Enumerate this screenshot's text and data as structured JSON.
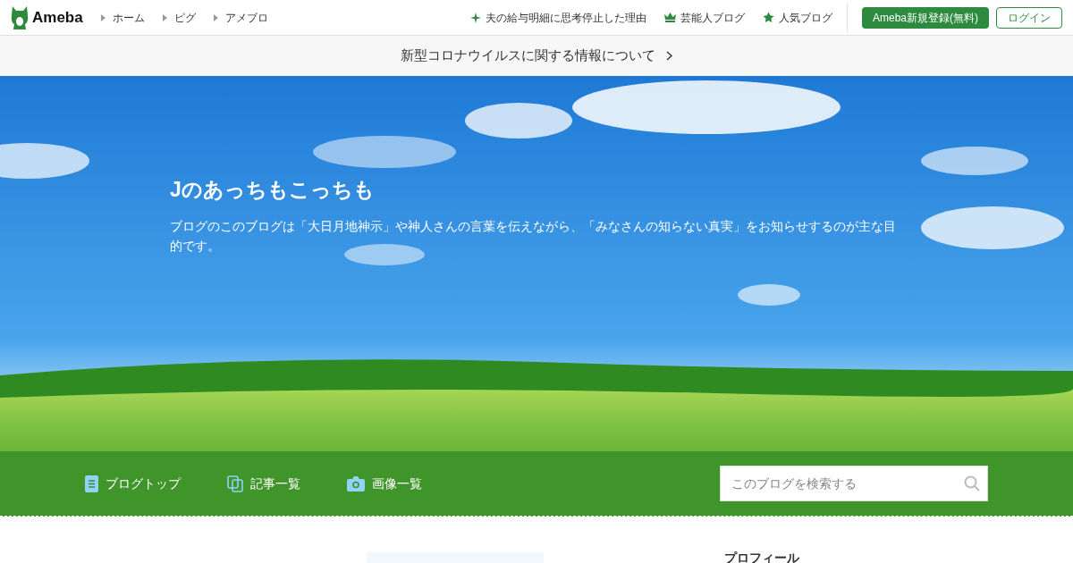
{
  "header": {
    "logo": "Ameba",
    "nav": [
      "ホーム",
      "ピグ",
      "アメブロ"
    ],
    "links": [
      {
        "kind": "sparkle",
        "label": "夫の給与明細に思考停止した理由"
      },
      {
        "kind": "crown",
        "label": "芸能人ブログ"
      },
      {
        "kind": "star",
        "label": "人気ブログ"
      }
    ],
    "signup": "Ameba新規登録(無料)",
    "login": "ログイン"
  },
  "notice": "新型コロナウイルスに関する情報について",
  "blog": {
    "title": "Jのあっちもこっちも",
    "description": "ブログのこのブログは「大日月地神示」や神人さんの言葉を伝えながら、「みなさんの知らない真実」をお知らせするのが主な目的です。"
  },
  "blog_nav": [
    {
      "kind": "top",
      "label": "ブログトップ"
    },
    {
      "kind": "entries",
      "label": "記事一覧"
    },
    {
      "kind": "images",
      "label": "画像一覧"
    }
  ],
  "search": {
    "placeholder": "このブログを検索する"
  },
  "sidebar": {
    "heading": "プロフィール"
  }
}
